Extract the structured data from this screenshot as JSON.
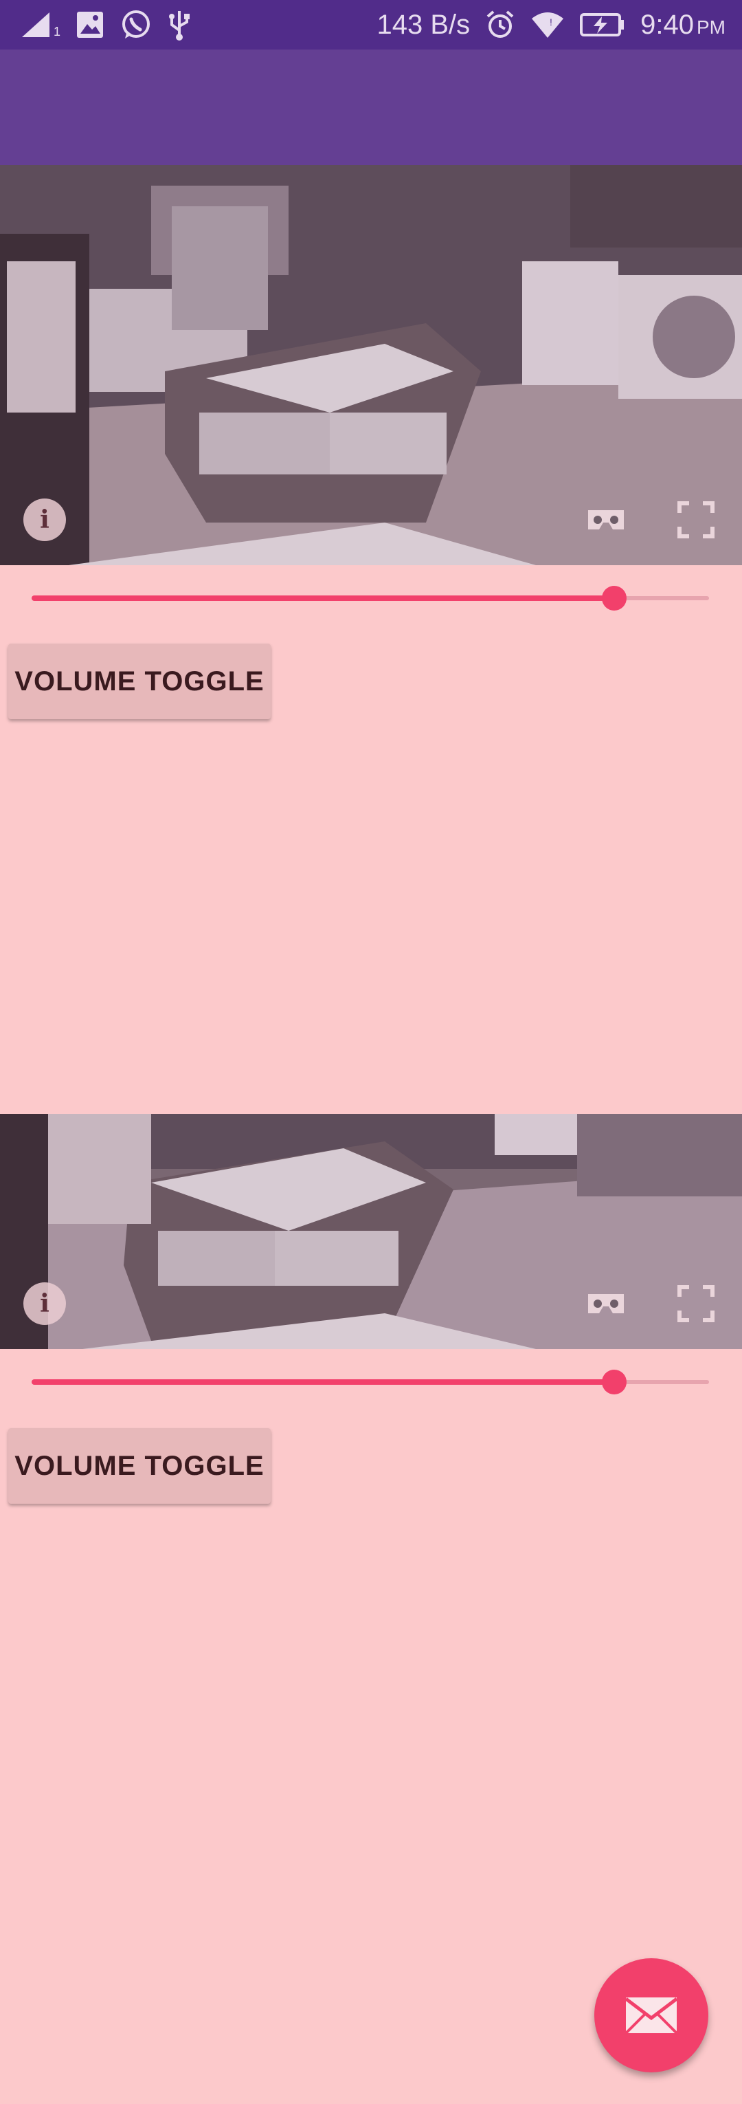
{
  "status_bar": {
    "signal_sub": "1",
    "net_speed": "143 B/s",
    "time": "9:40",
    "ampm": "PM",
    "left_icons": [
      "signal-icon",
      "gallery-icon",
      "whatsapp-icon",
      "usb-icon"
    ],
    "right_icons": [
      "alarm-icon",
      "wifi-icon",
      "battery-charging-icon"
    ]
  },
  "app_bar": {
    "color": "#643f93"
  },
  "videos": [
    {
      "info_label": "i",
      "icons": [
        "info-icon",
        "cardboard-vr-icon",
        "fullscreen-icon"
      ],
      "seek_progress": 0.86,
      "volume_button": "VOLUME TOGGLE"
    },
    {
      "info_label": "i",
      "icons": [
        "info-icon",
        "cardboard-vr-icon",
        "fullscreen-icon"
      ],
      "seek_progress": 0.86,
      "volume_button": "VOLUME TOGGLE"
    }
  ],
  "fab": {
    "icon": "mail-icon"
  },
  "colors": {
    "background": "#fcc9cb",
    "status_bar": "#512c8a",
    "accent": "#f2406b",
    "button": "#e7b8ba"
  }
}
